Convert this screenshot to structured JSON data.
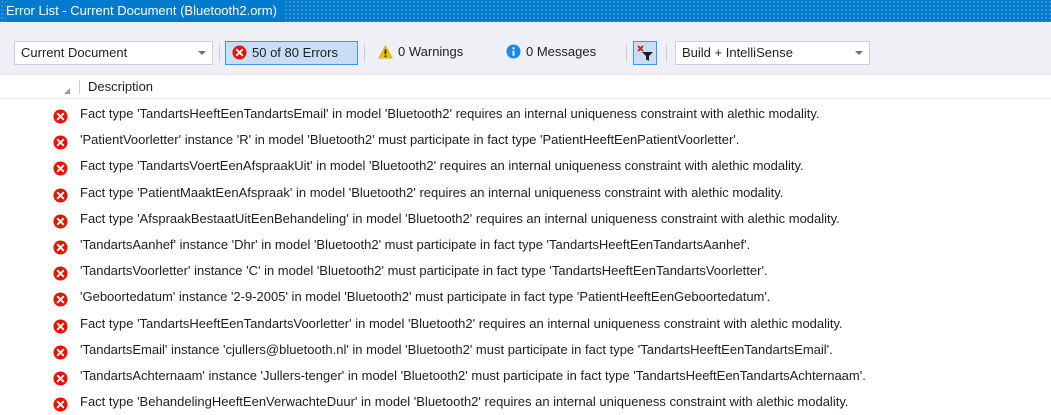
{
  "titlebar": {
    "title": "Error List - Current Document (Bluetooth2.orm)"
  },
  "toolbar": {
    "scope": "Current Document",
    "errors_label": "50 of 80 Errors",
    "warnings_label": "0 Warnings",
    "messages_label": "0 Messages",
    "build_source": "Build + IntelliSense"
  },
  "columns": {
    "description": "Description"
  },
  "colors": {
    "error": "#e51400",
    "warning": "#f2c200",
    "info": "#1e88e5",
    "accent": "#007acc"
  },
  "errors": [
    "Fact type 'TandartsHeeftEenTandartsEmail' in model 'Bluetooth2' requires an internal uniqueness constraint with alethic modality.",
    "'PatientVoorletter' instance 'R' in model 'Bluetooth2' must participate in fact type 'PatientHeeftEenPatientVoorletter'.",
    "Fact type 'TandartsVoertEenAfspraakUit' in model 'Bluetooth2' requires an internal uniqueness constraint with alethic modality.",
    "Fact type 'PatientMaaktEenAfspraak' in model 'Bluetooth2' requires an internal uniqueness constraint with alethic modality.",
    "Fact type 'AfspraakBestaatUitEenBehandeling' in model 'Bluetooth2' requires an internal uniqueness constraint with alethic modality.",
    "'TandartsAanhef' instance 'Dhr' in model 'Bluetooth2' must participate in fact type 'TandartsHeeftEenTandartsAanhef'.",
    "'TandartsVoorletter' instance 'C' in model 'Bluetooth2' must participate in fact type 'TandartsHeeftEenTandartsVoorletter'.",
    "'Geboortedatum' instance '2-9-2005' in model 'Bluetooth2' must participate in fact type 'PatientHeeftEenGeboortedatum'.",
    "Fact type 'TandartsHeeftEenTandartsVoorletter' in model 'Bluetooth2' requires an internal uniqueness constraint with alethic modality.",
    "'TandartsEmail' instance 'cjullers@bluetooth.nl' in model 'Bluetooth2' must participate in fact type 'TandartsHeeftEenTandartsEmail'.",
    "'TandartsAchternaam' instance 'Jullers-tenger' in model 'Bluetooth2' must participate in fact type 'TandartsHeeftEenTandartsAchternaam'.",
    "Fact type 'BehandelingHeeftEenVerwachteDuur' in model 'Bluetooth2' requires an internal uniqueness constraint with alethic modality."
  ]
}
